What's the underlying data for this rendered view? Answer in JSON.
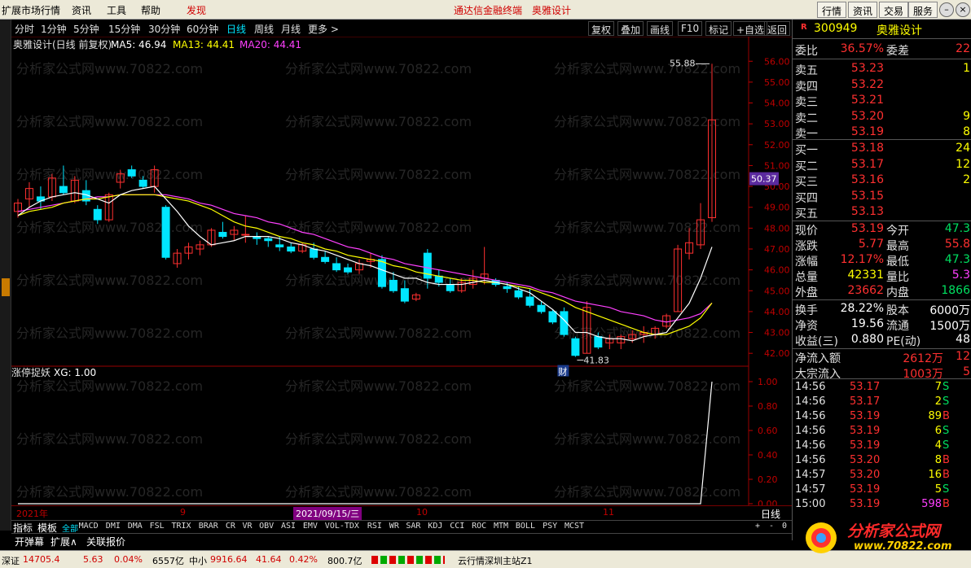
{
  "menubar": {
    "items": [
      "扩展市场行情",
      "资讯",
      "工具",
      "帮助"
    ],
    "discover": "发现",
    "center_title": "通达信金融终端",
    "center_stock": "奥雅设计",
    "right_buttons": [
      "行情",
      "资讯",
      "交易",
      "服务"
    ]
  },
  "periods": {
    "items": [
      "分时",
      "1分钟",
      "5分钟",
      "15分钟",
      "30分钟",
      "60分钟",
      "日线",
      "周线",
      "月线",
      "更多 >"
    ],
    "active": "日线",
    "tools": [
      "复权",
      "叠加",
      "画线",
      "F10",
      "标记",
      "+自选",
      "返回"
    ]
  },
  "legend": {
    "name": "奥雅设计(日线 前复权)",
    "ma5": "MA5: 46.94",
    "ma13": "MA13: 44.41",
    "ma20": "MA20: 44.41",
    "sub_title": "涨停捉妖",
    "sub_value": "XG: 1.00"
  },
  "annotations": {
    "high": "55.88",
    "low": "41.83",
    "price_marker": "50.37",
    "event": "财"
  },
  "colors": {
    "up": "#ff3030",
    "down": "#00e5ff",
    "ma5": "#ffffff",
    "ma13": "#ffff00",
    "ma20": "#ff40ff",
    "axis": "#c00000"
  },
  "chart_data": {
    "type": "candlestick",
    "title": "奥雅设计(日线 前复权)",
    "y_ticks": [
      "56.00",
      "55.00",
      "54.00",
      "53.00",
      "52.00",
      "51.00",
      "50.00",
      "49.00",
      "48.00",
      "47.00",
      "46.00",
      "45.00",
      "44.00",
      "43.00",
      "42.00"
    ],
    "ylim": [
      41.5,
      56.4
    ],
    "sub_y_ticks": [
      "1.00",
      "0.80",
      "0.60",
      "0.40",
      "0.20",
      "0.00"
    ],
    "x_labels": [
      "2021年",
      "9",
      "2021/09/15/三",
      "10",
      "11"
    ],
    "period_label": "日线",
    "candles": [
      {
        "o": 48.8,
        "h": 49.4,
        "l": 48.5,
        "c": 49.2
      },
      {
        "o": 49.4,
        "h": 50.2,
        "l": 49.0,
        "c": 49.9
      },
      {
        "o": 49.5,
        "h": 50.0,
        "l": 48.9,
        "c": 49.3
      },
      {
        "o": 49.5,
        "h": 50.6,
        "l": 49.3,
        "c": 50.4
      },
      {
        "o": 50.0,
        "h": 51.0,
        "l": 49.6,
        "c": 49.7
      },
      {
        "o": 49.3,
        "h": 50.5,
        "l": 49.2,
        "c": 50.3
      },
      {
        "o": 49.8,
        "h": 50.3,
        "l": 49.1,
        "c": 49.3
      },
      {
        "o": 48.9,
        "h": 49.1,
        "l": 48.2,
        "c": 48.4
      },
      {
        "o": 48.4,
        "h": 49.7,
        "l": 48.3,
        "c": 49.6
      },
      {
        "o": 50.2,
        "h": 50.8,
        "l": 49.9,
        "c": 50.6
      },
      {
        "o": 50.8,
        "h": 51.0,
        "l": 50.4,
        "c": 50.5
      },
      {
        "o": 50.3,
        "h": 50.5,
        "l": 49.9,
        "c": 50.0
      },
      {
        "o": 50.0,
        "h": 51.0,
        "l": 49.7,
        "c": 50.8
      },
      {
        "o": 49.0,
        "h": 49.1,
        "l": 46.5,
        "c": 46.6
      },
      {
        "o": 46.3,
        "h": 47.0,
        "l": 46.1,
        "c": 46.8
      },
      {
        "o": 46.8,
        "h": 47.3,
        "l": 46.5,
        "c": 47.1
      },
      {
        "o": 47.0,
        "h": 47.4,
        "l": 46.7,
        "c": 47.2
      },
      {
        "o": 47.2,
        "h": 48.0,
        "l": 47.1,
        "c": 47.9
      },
      {
        "o": 47.8,
        "h": 48.3,
        "l": 47.5,
        "c": 47.6
      },
      {
        "o": 47.7,
        "h": 48.1,
        "l": 47.4,
        "c": 47.9
      },
      {
        "o": 47.7,
        "h": 48.6,
        "l": 47.3,
        "c": 47.7
      },
      {
        "o": 47.6,
        "h": 47.8,
        "l": 47.2,
        "c": 47.5
      },
      {
        "o": 47.5,
        "h": 47.6,
        "l": 47.1,
        "c": 47.4
      },
      {
        "o": 47.2,
        "h": 47.6,
        "l": 46.9,
        "c": 47.1
      },
      {
        "o": 47.1,
        "h": 47.3,
        "l": 46.8,
        "c": 46.9
      },
      {
        "o": 46.9,
        "h": 47.3,
        "l": 46.8,
        "c": 47.2
      },
      {
        "o": 47.0,
        "h": 47.3,
        "l": 46.5,
        "c": 46.6
      },
      {
        "o": 46.6,
        "h": 46.9,
        "l": 46.3,
        "c": 46.4
      },
      {
        "o": 46.3,
        "h": 46.6,
        "l": 45.9,
        "c": 46.0
      },
      {
        "o": 46.1,
        "h": 46.3,
        "l": 45.8,
        "c": 45.9
      },
      {
        "o": 46.0,
        "h": 46.5,
        "l": 45.8,
        "c": 46.3
      },
      {
        "o": 46.4,
        "h": 46.8,
        "l": 46.1,
        "c": 46.5
      },
      {
        "o": 46.5,
        "h": 46.7,
        "l": 45.1,
        "c": 45.2
      },
      {
        "o": 45.5,
        "h": 45.9,
        "l": 44.9,
        "c": 45.0
      },
      {
        "o": 45.1,
        "h": 45.5,
        "l": 44.4,
        "c": 44.5
      },
      {
        "o": 44.6,
        "h": 44.9,
        "l": 44.5,
        "c": 44.8
      },
      {
        "o": 46.8,
        "h": 47.0,
        "l": 45.1,
        "c": 45.6
      },
      {
        "o": 45.7,
        "h": 46.0,
        "l": 45.2,
        "c": 45.4
      },
      {
        "o": 45.3,
        "h": 45.6,
        "l": 44.9,
        "c": 45.0
      },
      {
        "o": 45.0,
        "h": 45.6,
        "l": 44.9,
        "c": 45.4
      },
      {
        "o": 45.3,
        "h": 46.0,
        "l": 45.1,
        "c": 45.6
      },
      {
        "o": 45.6,
        "h": 47.1,
        "l": 45.3,
        "c": 45.8
      },
      {
        "o": 45.5,
        "h": 45.6,
        "l": 45.2,
        "c": 45.3
      },
      {
        "o": 45.2,
        "h": 45.4,
        "l": 44.9,
        "c": 45.1
      },
      {
        "o": 45.0,
        "h": 45.2,
        "l": 44.6,
        "c": 44.7
      },
      {
        "o": 44.7,
        "h": 45.1,
        "l": 44.2,
        "c": 44.3
      },
      {
        "o": 44.3,
        "h": 44.5,
        "l": 43.9,
        "c": 44.0
      },
      {
        "o": 44.0,
        "h": 44.1,
        "l": 43.4,
        "c": 43.5
      },
      {
        "o": 44.0,
        "h": 44.2,
        "l": 42.8,
        "c": 42.9
      },
      {
        "o": 42.7,
        "h": 42.8,
        "l": 41.83,
        "c": 41.9
      },
      {
        "o": 42.0,
        "h": 44.5,
        "l": 42.0,
        "c": 44.2
      },
      {
        "o": 42.8,
        "h": 43.0,
        "l": 42.2,
        "c": 42.3
      },
      {
        "o": 42.5,
        "h": 42.9,
        "l": 42.2,
        "c": 42.7
      },
      {
        "o": 42.5,
        "h": 42.9,
        "l": 42.2,
        "c": 42.8
      },
      {
        "o": 42.7,
        "h": 43.1,
        "l": 42.5,
        "c": 42.9
      },
      {
        "o": 42.9,
        "h": 43.3,
        "l": 42.5,
        "c": 43.0
      },
      {
        "o": 42.9,
        "h": 43.3,
        "l": 42.7,
        "c": 43.2
      },
      {
        "o": 43.3,
        "h": 43.9,
        "l": 43.2,
        "c": 43.8
      },
      {
        "o": 44.0,
        "h": 47.2,
        "l": 44.0,
        "c": 47.0
      },
      {
        "o": 46.8,
        "h": 48.0,
        "l": 46.5,
        "c": 47.3
      },
      {
        "o": 47.2,
        "h": 49.2,
        "l": 47.0,
        "c": 48.4
      },
      {
        "o": 48.5,
        "h": 55.88,
        "l": 48.3,
        "c": 53.19
      }
    ],
    "ma5": [
      48.6,
      49.0,
      49.3,
      49.5,
      49.6,
      49.7,
      49.6,
      49.4,
      49.2,
      49.6,
      49.8,
      49.9,
      50.0,
      49.4,
      48.8,
      48.1,
      47.6,
      47.2,
      47.3,
      47.4,
      47.6,
      47.6,
      47.6,
      47.5,
      47.3,
      47.2,
      47.0,
      46.9,
      46.7,
      46.5,
      46.3,
      46.2,
      46.0,
      45.8,
      45.6,
      45.6,
      45.4,
      45.3,
      45.3,
      45.3,
      45.4,
      45.5,
      45.4,
      45.3,
      45.1,
      44.9,
      44.5,
      44.1,
      43.6,
      43.0,
      43.0,
      42.8,
      42.7,
      42.7,
      42.6,
      42.8,
      42.9,
      43.0,
      43.7,
      44.4,
      45.6,
      47.1
    ],
    "ma13": [
      48.6,
      48.8,
      48.9,
      49.0,
      49.2,
      49.3,
      49.4,
      49.4,
      49.5,
      49.6,
      49.6,
      49.6,
      49.6,
      49.5,
      49.4,
      49.3,
      49.1,
      48.9,
      48.6,
      48.3,
      48.1,
      48.0,
      47.8,
      47.6,
      47.5,
      47.3,
      47.2,
      47.0,
      46.9,
      46.7,
      46.6,
      46.5,
      46.4,
      46.2,
      46.1,
      45.9,
      45.8,
      45.7,
      45.6,
      45.5,
      45.5,
      45.4,
      45.4,
      45.3,
      45.2,
      45.1,
      44.9,
      44.7,
      44.5,
      44.2,
      44.0,
      43.8,
      43.6,
      43.4,
      43.2,
      43.0,
      42.9,
      42.9,
      43.1,
      43.3,
      43.7,
      44.41
    ],
    "ma20": [
      48.8,
      48.9,
      49.0,
      49.1,
      49.2,
      49.3,
      49.4,
      49.5,
      49.5,
      49.6,
      49.6,
      49.6,
      49.6,
      49.6,
      49.5,
      49.4,
      49.2,
      49.1,
      48.9,
      48.7,
      48.6,
      48.5,
      48.3,
      48.2,
      48.0,
      47.8,
      47.7,
      47.5,
      47.3,
      47.1,
      47.0,
      46.8,
      46.6,
      46.5,
      46.3,
      46.2,
      46.1,
      46.0,
      45.9,
      45.8,
      45.7,
      45.6,
      45.5,
      45.4,
      45.3,
      45.2,
      45.0,
      44.9,
      44.7,
      44.5,
      44.4,
      44.3,
      44.2,
      44.0,
      43.9,
      43.8,
      43.6,
      43.5,
      43.6,
      43.7,
      43.9,
      44.41
    ],
    "sub_series": [
      0,
      0,
      0,
      0,
      0,
      0,
      0,
      0,
      0,
      0,
      0,
      0,
      0,
      0,
      0,
      0,
      0,
      0,
      0,
      0,
      0,
      0,
      0,
      0,
      0,
      0,
      0,
      0,
      0,
      0,
      0,
      0,
      0,
      0,
      0,
      0,
      0,
      0,
      0,
      0,
      0,
      0,
      0,
      0,
      0,
      0,
      0,
      0,
      0,
      0,
      0,
      0,
      0,
      0,
      0,
      0,
      0,
      0,
      0,
      0,
      0,
      1
    ]
  },
  "quote": {
    "code": "300949",
    "name": "奥雅设计",
    "r_mark": "R",
    "weibi_label": "委比",
    "weibi": "36.57%",
    "weicha_label": "委差",
    "weicha": "22",
    "asks": [
      {
        "label": "卖五",
        "price": "53.23",
        "vol": "1"
      },
      {
        "label": "卖四",
        "price": "53.22",
        "vol": ""
      },
      {
        "label": "卖三",
        "price": "53.21",
        "vol": ""
      },
      {
        "label": "卖二",
        "price": "53.20",
        "vol": "9"
      },
      {
        "label": "卖一",
        "price": "53.19",
        "vol": "8"
      }
    ],
    "bids": [
      {
        "label": "买一",
        "price": "53.18",
        "vol": "24"
      },
      {
        "label": "买二",
        "price": "53.17",
        "vol": "12"
      },
      {
        "label": "买三",
        "price": "53.16",
        "vol": "2"
      },
      {
        "label": "买四",
        "price": "53.15",
        "vol": ""
      },
      {
        "label": "买五",
        "price": "53.13",
        "vol": ""
      }
    ],
    "stats": [
      {
        "l1": "现价",
        "v1": "53.19",
        "c1": "red",
        "l2": "今开",
        "v2": "47.3",
        "c2": "grn"
      },
      {
        "l1": "涨跌",
        "v1": "5.77",
        "c1": "red",
        "l2": "最高",
        "v2": "55.8",
        "c2": "red"
      },
      {
        "l1": "涨幅",
        "v1": "12.17%",
        "c1": "red",
        "l2": "最低",
        "v2": "47.3",
        "c2": "grn"
      },
      {
        "l1": "总量",
        "v1": "42331",
        "c1": "yel",
        "l2": "量比",
        "v2": "5.3",
        "c2": "mag"
      },
      {
        "l1": "外盘",
        "v1": "23662",
        "c1": "red",
        "l2": "内盘",
        "v2": "1866",
        "c2": "grn"
      }
    ],
    "stats2": [
      {
        "l1": "换手",
        "v1": "28.22%",
        "l2": "股本",
        "v2": "6000万"
      },
      {
        "l1": "净资",
        "v1": "19.56",
        "l2": "流通",
        "v2": "1500万"
      },
      {
        "l1": "收益(三)",
        "v1": "0.880",
        "l2": "PE(动)",
        "v2": "48"
      }
    ],
    "flow": [
      {
        "label": "净流入额",
        "value": "2612万",
        "extra": "12"
      },
      {
        "label": "大宗流入",
        "value": "1003万",
        "extra": "5"
      }
    ],
    "ticks": [
      {
        "t": "14:56",
        "p": "53.17",
        "q": "7",
        "f": "S"
      },
      {
        "t": "14:56",
        "p": "53.17",
        "q": "2",
        "f": "S"
      },
      {
        "t": "14:56",
        "p": "53.19",
        "q": "89",
        "f": "B"
      },
      {
        "t": "14:56",
        "p": "53.19",
        "q": "6",
        "f": "S"
      },
      {
        "t": "14:56",
        "p": "53.19",
        "q": "4",
        "f": "S"
      },
      {
        "t": "14:56",
        "p": "53.20",
        "q": "8",
        "f": "B"
      },
      {
        "t": "14:57",
        "p": "53.20",
        "q": "16",
        "f": "B"
      },
      {
        "t": "14:57",
        "p": "53.19",
        "q": "5",
        "f": "S"
      },
      {
        "t": "15:00",
        "p": "53.19",
        "q": "598",
        "f": "B"
      }
    ]
  },
  "indicators": {
    "first": "指标",
    "second": "模板",
    "items": [
      "全部",
      "MACD",
      "DMI",
      "DMA",
      "FSL",
      "TRIX",
      "BRAR",
      "CR",
      "VR",
      "OBV",
      "ASI",
      "EMV",
      "VOL-TDX",
      "RSI",
      "WR",
      "SAR",
      "KDJ",
      "CCI",
      "ROC",
      "MTM",
      "BOLL",
      "PSY",
      "MCST"
    ],
    "selected": "全部",
    "right": [
      "+",
      "-",
      "0"
    ]
  },
  "tabs": [
    "开弹幕",
    "扩展∧",
    "关联报价"
  ],
  "status": {
    "index1_name": "深证",
    "index1": "14705.4",
    "index1_chg": "5.63",
    "index1_pct": "0.04%",
    "index1_amt": "6557亿",
    "index2_name": "中小",
    "index2": "9916.64",
    "index2_chg": "41.64",
    "index2_pct": "0.42%",
    "index2_amt": "800.7亿",
    "server": "云行情深圳主站Z1"
  },
  "logo": {
    "big": "分析家公式网",
    "small": "www.70822.com"
  }
}
